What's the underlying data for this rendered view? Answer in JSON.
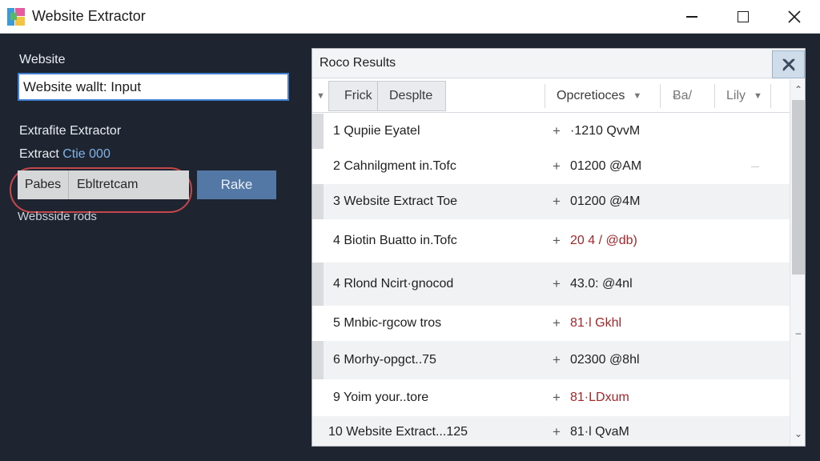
{
  "window": {
    "title": "Website Extractor",
    "controls": {
      "minimize": "minimize",
      "maximize": "maximize",
      "close": "close"
    }
  },
  "left": {
    "website_label": "Website",
    "url_input_value": "Website wallt: Input",
    "section_label": "Extrafite Extractor",
    "extract_prefix": "Extract",
    "extract_accent": "Ctie 000",
    "segment_first": "Pabes",
    "segment_second": "Ebltretcam",
    "run_button": "Rake",
    "hint": "Websside rods"
  },
  "results": {
    "title": "Roco Results",
    "columns": {
      "tab1": "Frick",
      "tab2": "Desplte",
      "col3": "Opcretioces",
      "col4": "Ƀa/",
      "col5": "Lily"
    },
    "rows": [
      {
        "name": "1  Qupiie Eyatel",
        "plus": "+",
        "value": "·1210 QvvM",
        "red": false
      },
      {
        "name": "2  Cahnilgment in.Tofc",
        "plus": "+",
        "value": "01200 @AM",
        "red": false
      },
      {
        "name": "3  Website Extract Toe",
        "plus": "+",
        "value": "01200 @4M",
        "red": false
      },
      {
        "name": "4  Biotin Buatto in.Tofc",
        "plus": "+",
        "value": "20 4 / @db)",
        "red": true
      },
      {
        "name": "4  Rlond Ncirt·gnocod",
        "plus": "+",
        "value": "43.0: @4nl",
        "red": false
      },
      {
        "name": "5  Mnbic-rgcow tros",
        "plus": "+",
        "value": "81·l Gkhl",
        "red": true
      },
      {
        "name": "6  Morhy-opgct..75",
        "plus": "+",
        "value": "02300 @8hl",
        "red": false
      },
      {
        "name": "9  Yoim your..tore",
        "plus": "+",
        "value": "81·LDxum",
        "red": true
      },
      {
        "name": "10  Website Extract...125",
        "plus": "+",
        "value": "81·l QvaM",
        "red": true
      }
    ]
  },
  "colors": {
    "background": "#1f2530",
    "accent_blue": "#3f7fd1",
    "button": "#5478a6",
    "highlight_ring": "#c4484b",
    "value_red": "#a3272b"
  }
}
